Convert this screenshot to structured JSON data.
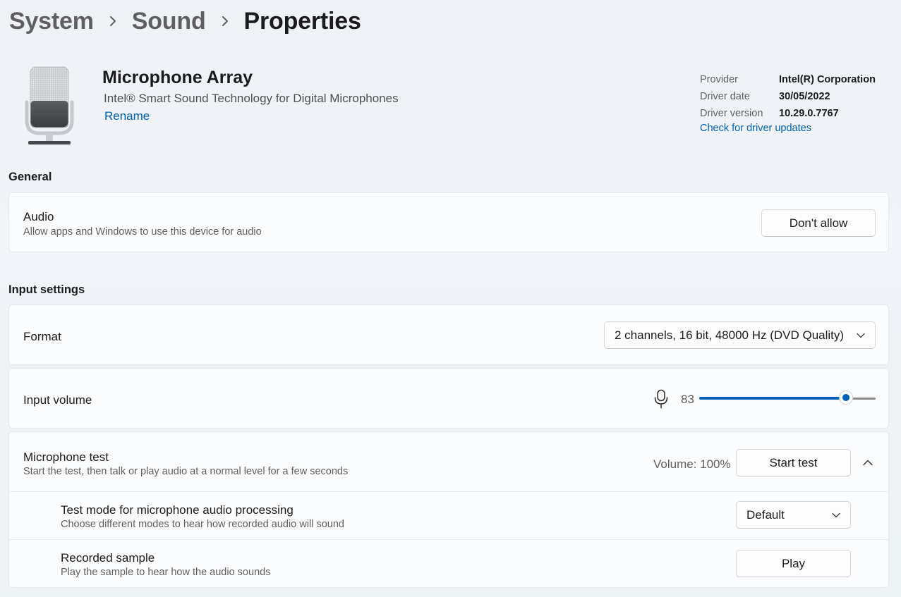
{
  "breadcrumb": {
    "items": [
      "System",
      "Sound"
    ],
    "current": "Properties"
  },
  "device": {
    "name": "Microphone Array",
    "description": "Intel® Smart Sound Technology for Digital Microphones",
    "rename_label": "Rename",
    "icon": "microphone-icon"
  },
  "driver": {
    "provider_label": "Provider",
    "provider_value": "Intel(R) Corporation",
    "date_label": "Driver date",
    "date_value": "30/05/2022",
    "version_label": "Driver version",
    "version_value": "10.29.0.7767",
    "update_link": "Check for driver updates"
  },
  "general": {
    "section_title": "General",
    "audio": {
      "title": "Audio",
      "subtitle": "Allow apps and Windows to use this device for audio",
      "button_label": "Don't allow"
    }
  },
  "input_settings": {
    "section_title": "Input settings",
    "format": {
      "label": "Format",
      "selected": "2 channels, 16 bit, 48000 Hz (DVD Quality)"
    },
    "input_volume": {
      "label": "Input volume",
      "value": 83,
      "value_text": "83",
      "icon": "microphone-icon"
    },
    "mic_test": {
      "title": "Microphone test",
      "subtitle": "Start the test, then talk or play audio at a normal level for a few seconds",
      "volume_text": "Volume: 100%",
      "button_label": "Start test",
      "expanded": true
    },
    "test_mode": {
      "title": "Test mode for microphone audio processing",
      "subtitle": "Choose different modes to hear how recorded audio will sound",
      "selected": "Default"
    },
    "recorded_sample": {
      "title": "Recorded sample",
      "subtitle": "Play the sample to hear how the audio sounds",
      "button_label": "Play"
    }
  },
  "colors": {
    "accent": "#005fb8",
    "background": "#eef2f7",
    "card": "#fbfcfd"
  }
}
